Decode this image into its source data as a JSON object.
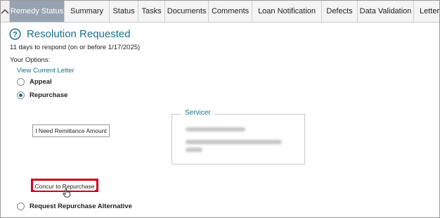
{
  "tabs": [
    {
      "label": "Remedy Status",
      "active": true
    },
    {
      "label": "Summary",
      "active": false
    },
    {
      "label": "Status",
      "active": false
    },
    {
      "label": "Tasks",
      "active": false
    },
    {
      "label": "Documents",
      "active": false
    },
    {
      "label": "Comments",
      "active": false
    },
    {
      "label": "Loan Notification",
      "active": false
    },
    {
      "label": "Defects",
      "active": false
    },
    {
      "label": "Data Validation",
      "active": false
    },
    {
      "label": "Letters",
      "active": false
    }
  ],
  "status": {
    "title": "Resolution Requested",
    "days_text": "11 days to respond (on or before 1/17/2025)"
  },
  "options": {
    "label": "Your Options:",
    "view_letter": "View Current Letter",
    "appeal_label": "Appeal",
    "appeal_checked": false,
    "repurchase_label": "Repurchase",
    "repurchase_checked": true,
    "remittance_button": "I Need Remittance Amount",
    "concur_button": "Concur to Repurchase",
    "alternative_label": "Request Repurchase Alternative",
    "alternative_checked": false
  },
  "servicer": {
    "legend": "Servicer"
  },
  "colors": {
    "accent": "#1a6f8e",
    "active_tab": "#97a3b1",
    "highlight": "#d0021b"
  }
}
